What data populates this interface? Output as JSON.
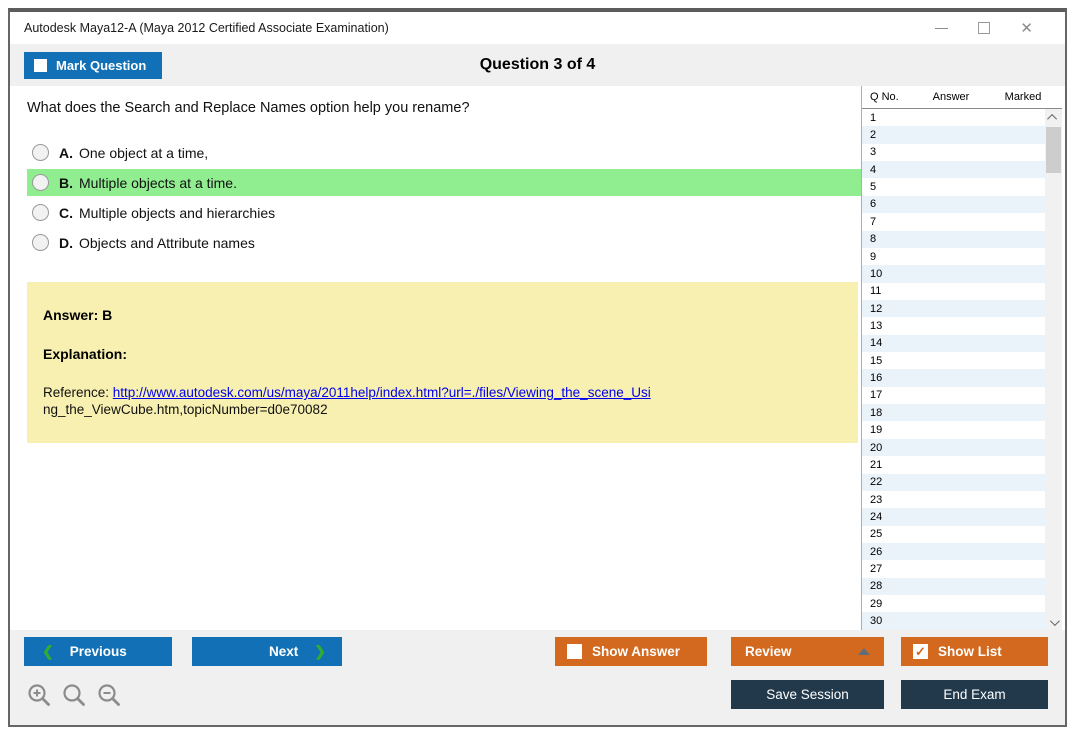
{
  "window": {
    "title": "Autodesk Maya12-A (Maya 2012 Certified Associate Examination)",
    "controls": [
      "minimize-icon",
      "maximize-icon",
      "close-icon"
    ],
    "close_glyph": "✕"
  },
  "header": {
    "mark_question_label": "Mark Question",
    "question_counter": "Question 3 of 4"
  },
  "question": {
    "text": "What does the Search and Replace Names option help you rename?",
    "options": [
      {
        "letter": "A.",
        "text": "One object at a time,",
        "highlighted": false
      },
      {
        "letter": "B.",
        "text": "Multiple objects at a time.",
        "highlighted": true
      },
      {
        "letter": "C.",
        "text": "Multiple objects and hierarchies",
        "highlighted": false
      },
      {
        "letter": "D.",
        "text": "Objects and Attribute names",
        "highlighted": false
      }
    ]
  },
  "answer_panel": {
    "answer_label": "Answer: B",
    "explanation_label": "Explanation:",
    "reference_prefix": "Reference: ",
    "reference_link": "http://www.autodesk.com/us/maya/2011help/index.html?url=./files/Viewing_the_scene_Usi",
    "reference_rest": "ng_the_ViewCube.htm,topicNumber=d0e70082"
  },
  "question_list": {
    "headers": {
      "qno": "Q No.",
      "answer": "Answer",
      "marked": "Marked"
    },
    "visible_rows": [
      "1",
      "2",
      "3",
      "4",
      "5",
      "6",
      "7",
      "8",
      "9",
      "10",
      "11",
      "12",
      "13",
      "14",
      "15",
      "16",
      "17",
      "18",
      "19",
      "20",
      "21",
      "22",
      "23",
      "24",
      "25",
      "26",
      "27",
      "28",
      "29",
      "30"
    ]
  },
  "footer": {
    "previous_label": "Previous",
    "next_label": "Next",
    "prev_chevron": "❮",
    "next_chevron": "❯",
    "show_answer_label": "Show Answer",
    "review_label": "Review",
    "show_list_label": "Show List",
    "show_list_check": "✓",
    "save_session_label": "Save Session",
    "end_exam_label": "End Exam",
    "zoom_icons": [
      "zoom-in-icon",
      "zoom-icon",
      "zoom-out-icon"
    ]
  },
  "colors": {
    "accent_blue": "#1271b6",
    "accent_orange": "#d2691e",
    "dark_navy": "#21394b",
    "highlight_green": "#90ee90",
    "answer_bg_yellow": "#f7f0b0",
    "nav_arrow_green": "#2fae2f",
    "alt_row_blue": "#eaf2fa",
    "link_blue": "#0000ee"
  }
}
